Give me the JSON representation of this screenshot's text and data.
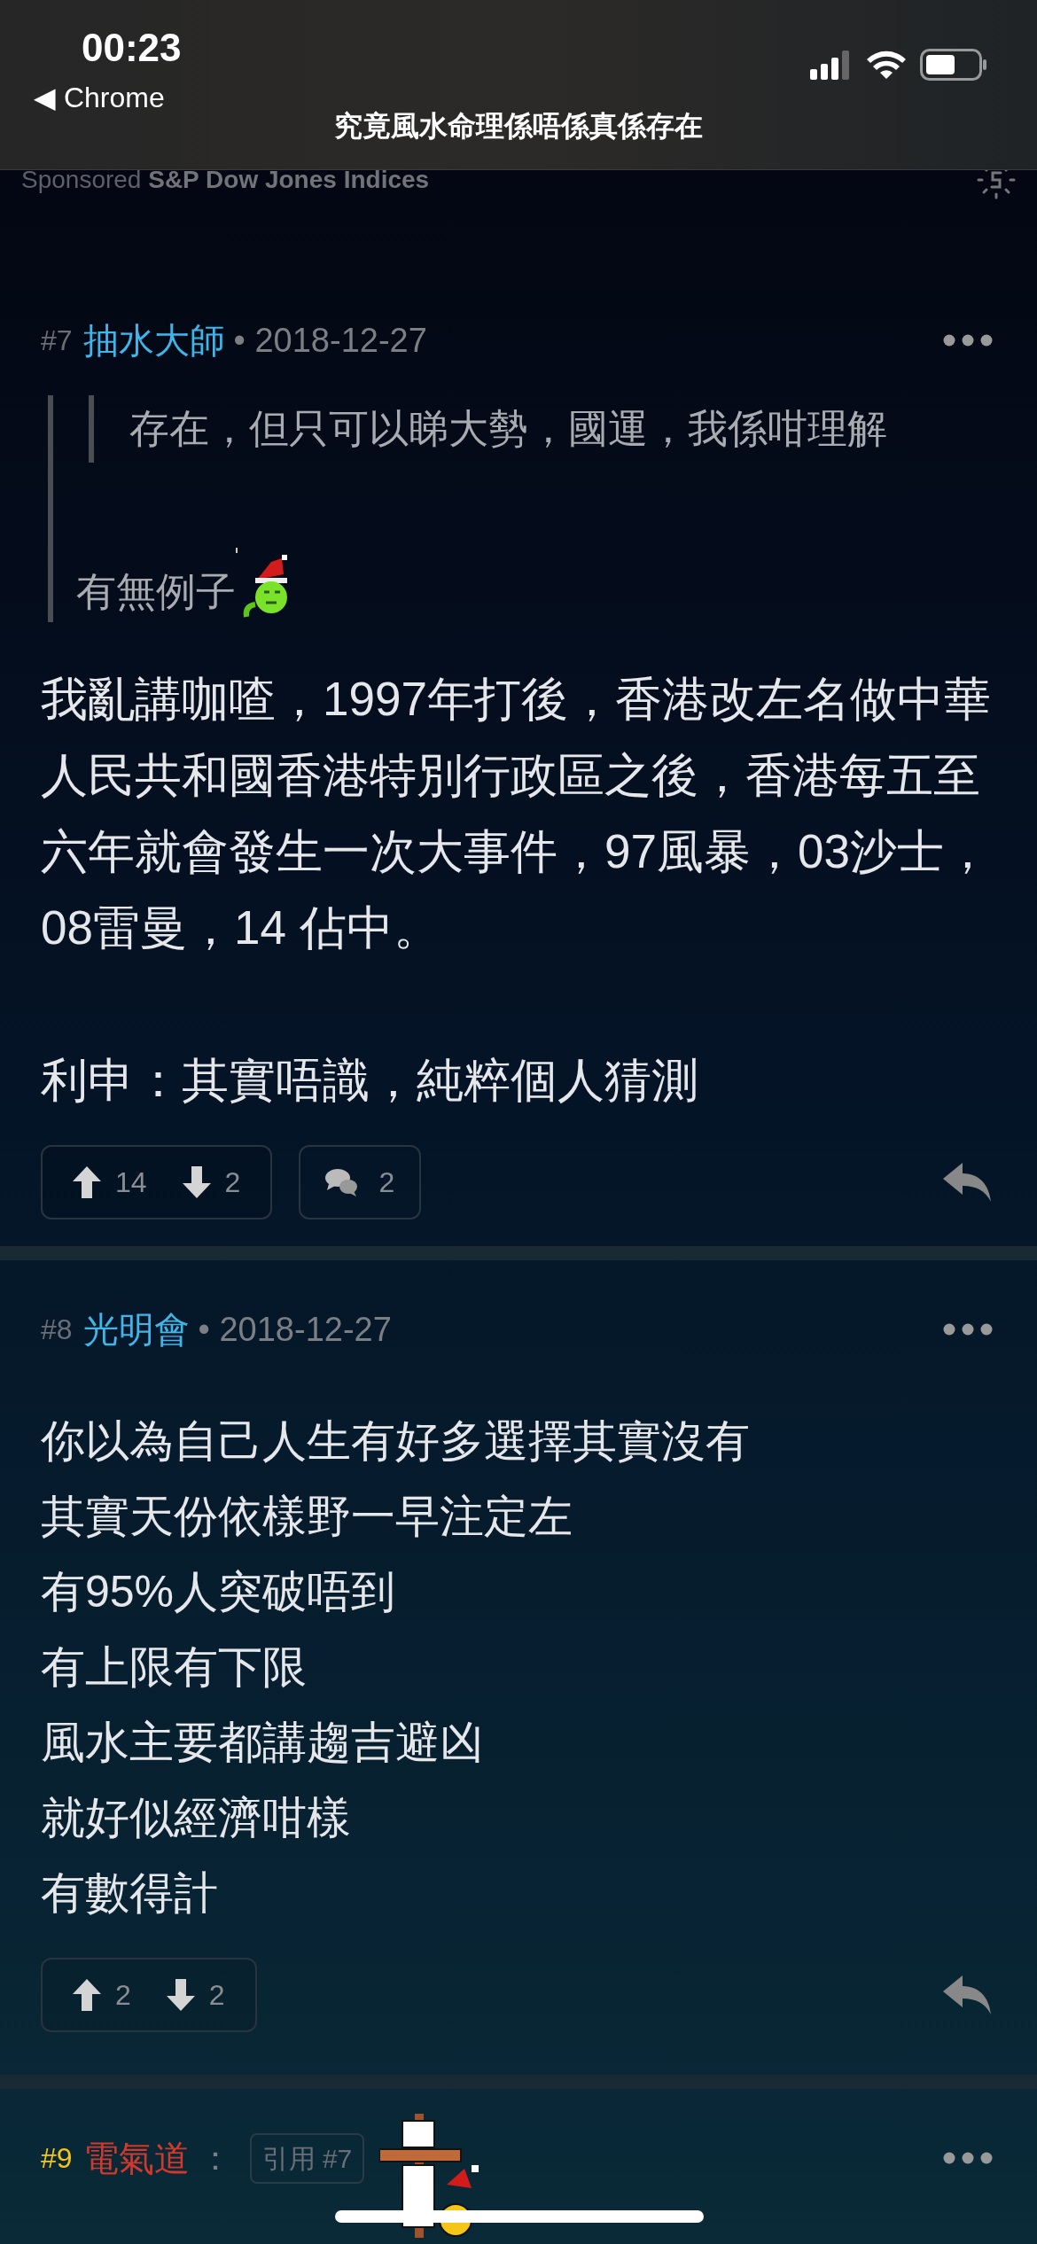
{
  "status_bar": {
    "time": "00:23",
    "back_app": "◀ Chrome"
  },
  "page_title": "究竟風水命理係唔係真係存在",
  "sponsor": {
    "label": "Sponsored",
    "name": "S&P Dow Jones Indices"
  },
  "posts": [
    {
      "number": "#7",
      "author": "抽水大師",
      "color": "#3fb6ea",
      "date": "• 2018-12-27",
      "quote": {
        "nested": "存在，但只可以睇大勢，國運，我係咁理解",
        "text": "有無例子"
      },
      "body": [
        "我亂講咖喳，1997年打後，香港改左名做中華人民共和國香港特別行政區之後，香港每五至六年就會發生一次大事件，97風暴，03沙士，08雷曼，14 佔中。",
        "利申：其實唔識，純粹個人猜測"
      ],
      "upvotes": "14",
      "downvotes": "2",
      "replies": "2"
    },
    {
      "number": "#8",
      "author": "光明會",
      "color": "#3fb6ea",
      "date": "• 2018-12-27",
      "lines": [
        "你以為自己人生有好多選擇其實沒有",
        "其實天份依樣野一早注定左",
        "有95%人突破唔到",
        "有上限有下限",
        "風水主要都講趨吉避凶",
        "就好似經濟咁樣",
        "有數得計"
      ],
      "upvotes": "2",
      "downvotes": "2"
    },
    {
      "number": "#9",
      "author": "電氣道",
      "color": "#d0392b",
      "date": "：",
      "quote_ref": "引用 #7"
    }
  ]
}
